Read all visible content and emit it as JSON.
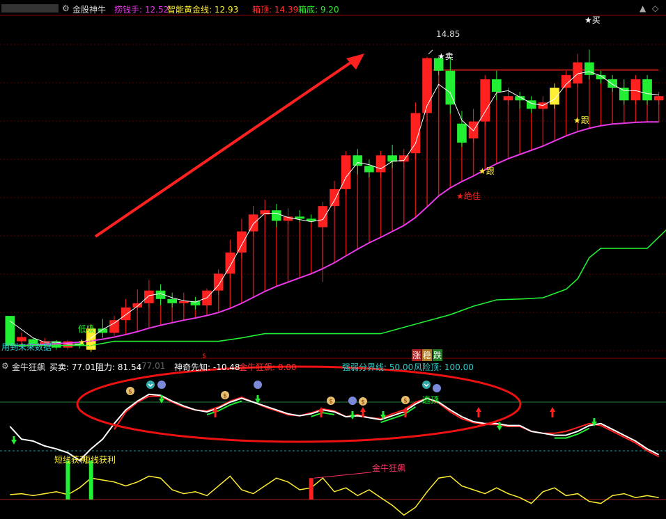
{
  "header": {
    "stock_name": "金股神牛",
    "lao_qian_shou": "捞钱手: 12.52",
    "zhi_neng_huang_jin_xian": "智能黄金线: 12.93",
    "xiang_ding": "箱顶: 14.39",
    "xiang_di": "箱底: 9.20"
  },
  "sub_header": {
    "indicator_name": "金牛狂飙",
    "mai_mai": "买卖: 77.01",
    "zu_li": "阻力: 81.54",
    "zu_li_2": "77.01",
    "shen_qi_xian_zhi": "神奇先知: -10.48",
    "jin_niu_kuang_biao": "金牛狂飙: 0.00",
    "qiang_ruo_fen_jie_xian": "强弱分界线: 50.00",
    "feng_xian_ding": "风险顶: 100.00"
  },
  "annotations": {
    "peak_price": "14.85",
    "sell_1": "卖",
    "buy_1": "买",
    "follow_1": "跟",
    "follow_2": "跟",
    "follow_3": "跟",
    "best": "绝佳",
    "low_buy": "低吸",
    "future_data": "用到未来数据",
    "zhang": "涨",
    "wen": "稳",
    "die": "跌",
    "short_profit": "短线获利",
    "gold_bull_label": "金牛狂飙",
    "escape_top": "逃顶"
  },
  "colors": {
    "up": "#ff2020",
    "down": "#22ee33",
    "yellow": "#ffee33",
    "magenta": "#e838e8",
    "white": "#ffffff",
    "cyan": "#33cccc",
    "red_annot": "#ff2020",
    "bg": "#000000"
  },
  "chart_data": [
    {
      "type": "candlestick",
      "title": "金股神牛",
      "ylim": [
        7.8,
        15.8
      ],
      "candles": [
        [
          8.72,
          8.02,
          8.02,
          8.72
        ],
        [
          8.12,
          8.22,
          8.02,
          8.32
        ],
        [
          8.17,
          8.05,
          8.0,
          8.2
        ],
        [
          8.05,
          8.12,
          7.97,
          8.2
        ],
        [
          8.12,
          7.97,
          7.92,
          8.15
        ],
        [
          7.97,
          8.12,
          7.92,
          8.15
        ],
        [
          8.07,
          8.02,
          7.95,
          8.12
        ],
        [
          7.92,
          8.42,
          7.87,
          8.52
        ],
        [
          8.42,
          8.32,
          8.2,
          8.65
        ],
        [
          8.32,
          8.62,
          8.25,
          8.72
        ],
        [
          8.62,
          8.92,
          8.55,
          9.12
        ],
        [
          8.92,
          9.02,
          8.85,
          9.35
        ],
        [
          9.02,
          9.32,
          8.92,
          9.57
        ],
        [
          9.32,
          9.12,
          8.97,
          9.47
        ],
        [
          9.12,
          9.02,
          8.92,
          9.27
        ],
        [
          9.02,
          9.07,
          8.95,
          9.27
        ],
        [
          9.07,
          8.97,
          8.87,
          9.17
        ],
        [
          8.97,
          9.32,
          8.9,
          9.37
        ],
        [
          9.32,
          9.72,
          9.22,
          9.82
        ],
        [
          9.72,
          10.22,
          9.6,
          10.52
        ],
        [
          10.22,
          10.72,
          10.07,
          11.02
        ],
        [
          10.72,
          11.12,
          10.6,
          11.32
        ],
        [
          11.12,
          11.22,
          10.97,
          11.47
        ],
        [
          11.22,
          10.97,
          10.82,
          11.37
        ],
        [
          10.97,
          11.07,
          10.9,
          11.27
        ],
        [
          11.07,
          11.02,
          10.95,
          11.22
        ],
        [
          11.02,
          10.97,
          10.92,
          11.12
        ],
        [
          10.82,
          11.32,
          9.52,
          11.42
        ],
        [
          11.32,
          11.72,
          11.2,
          11.92
        ],
        [
          11.72,
          12.52,
          11.6,
          12.62
        ],
        [
          12.52,
          12.27,
          12.07,
          12.67
        ],
        [
          12.27,
          12.12,
          12.0,
          12.42
        ],
        [
          12.12,
          12.52,
          12.0,
          12.62
        ],
        [
          12.52,
          12.37,
          12.22,
          12.77
        ],
        [
          12.37,
          12.52,
          12.22,
          12.67
        ],
        [
          12.57,
          13.52,
          12.42,
          13.77
        ],
        [
          13.52,
          14.82,
          13.32,
          14.85
        ],
        [
          14.82,
          14.52,
          14.42,
          14.85
        ],
        [
          14.52,
          13.72,
          13.5,
          14.85
        ],
        [
          13.27,
          12.82,
          12.72,
          13.57
        ],
        [
          12.92,
          13.32,
          12.82,
          13.62
        ],
        [
          13.32,
          14.32,
          13.22,
          14.42
        ],
        [
          14.32,
          14.02,
          13.82,
          14.52
        ],
        [
          13.82,
          13.92,
          13.72,
          14.12
        ],
        [
          13.92,
          13.82,
          13.62,
          14.02
        ],
        [
          13.82,
          13.62,
          13.52,
          13.92
        ],
        [
          13.62,
          13.77,
          13.57,
          13.92
        ],
        [
          13.72,
          14.12,
          13.62,
          14.22
        ],
        [
          14.12,
          14.42,
          14.02,
          14.52
        ],
        [
          14.22,
          14.72,
          14.12,
          14.92
        ],
        [
          14.72,
          14.42,
          14.32,
          15.02
        ],
        [
          14.42,
          14.32,
          14.22,
          14.52
        ],
        [
          14.32,
          14.12,
          14.02,
          14.42
        ],
        [
          14.12,
          13.82,
          13.72,
          14.32
        ],
        [
          13.82,
          14.32,
          13.72,
          14.42
        ],
        [
          14.32,
          13.82,
          13.72,
          14.42
        ],
        [
          13.82,
          13.92,
          13.72,
          14.02
        ]
      ],
      "yellow_candles": [
        7,
        47
      ],
      "pink_line": [
        8.02,
        8.02,
        8.03,
        8.05,
        8.06,
        8.08,
        8.1,
        8.13,
        8.17,
        8.22,
        8.28,
        8.35,
        8.43,
        8.5,
        8.56,
        8.62,
        8.67,
        8.73,
        8.8,
        8.9,
        9.02,
        9.16,
        9.3,
        9.42,
        9.52,
        9.62,
        9.72,
        9.84,
        9.98,
        10.14,
        10.3,
        10.45,
        10.58,
        10.72,
        10.86,
        11.05,
        11.3,
        11.56,
        11.75,
        11.9,
        12.03,
        12.18,
        12.32,
        12.44,
        12.54,
        12.64,
        12.74,
        12.86,
        12.98,
        13.08,
        13.16,
        13.22,
        13.26,
        13.28,
        13.3,
        13.31,
        13.31
      ],
      "white_line": [
        8.6,
        8.4,
        8.2,
        8.1,
        8.1,
        8.05,
        8.05,
        8.2,
        8.4,
        8.55,
        8.75,
        8.95,
        9.2,
        9.25,
        9.15,
        9.08,
        9.05,
        9.15,
        9.45,
        9.9,
        10.4,
        10.9,
        11.15,
        11.15,
        11.05,
        11.0,
        10.95,
        11.0,
        11.45,
        12.0,
        12.35,
        12.3,
        12.2,
        12.38,
        12.4,
        12.8,
        13.7,
        14.2,
        14.0,
        13.35,
        13.1,
        13.55,
        14.0,
        14.05,
        13.9,
        13.75,
        13.7,
        13.85,
        14.2,
        14.45,
        14.5,
        14.4,
        14.2,
        14.05,
        14.05,
        13.98,
        13.95
      ],
      "green_line": [
        8.02,
        8.02,
        8.02,
        8.02,
        8.02,
        8.02,
        8.02,
        8.02,
        8.02,
        8.02,
        8.02,
        8.02,
        8.02,
        8.02,
        8.02,
        8.02,
        8.02,
        8.02,
        8.02,
        8.02,
        8.02,
        8.02,
        8.02,
        8.02,
        8.02,
        8.02,
        8.02,
        8.02,
        8.02,
        8.02,
        8.02,
        8.02,
        8.02,
        8.02,
        8.02,
        8.02,
        8.02,
        8.02,
        8.02,
        8.02,
        8.02,
        8.02,
        8.02,
        8.02,
        8.02,
        8.02,
        8.02,
        8.02,
        8.02,
        8.02,
        8.02,
        8.02,
        8.02,
        8.02,
        8.02,
        8.02,
        8.02
      ],
      "green_line_poly": [
        [
          0,
          8.02
        ],
        [
          7,
          8.02
        ],
        [
          9,
          8.12
        ],
        [
          12,
          8.12
        ],
        [
          18,
          8.12
        ],
        [
          20,
          8.2
        ],
        [
          22,
          8.3
        ],
        [
          26,
          8.3
        ],
        [
          32,
          8.3
        ],
        [
          36,
          8.6
        ],
        [
          38,
          8.75
        ],
        [
          40,
          8.95
        ],
        [
          42,
          9.1
        ],
        [
          44,
          9.12
        ],
        [
          46,
          9.15
        ],
        [
          48,
          9.35
        ],
        [
          49,
          9.6
        ],
        [
          50,
          10.1
        ],
        [
          51,
          10.32
        ],
        [
          53,
          10.32
        ],
        [
          55,
          10.32
        ],
        [
          57,
          10.85
        ],
        [
          58,
          11.05
        ],
        [
          59,
          11.1
        ]
      ]
    },
    {
      "type": "line",
      "title": "金牛狂飙",
      "ylim": [
        -20,
        130
      ],
      "reference_lines": {
        "强弱分界线": 50.0,
        "风险顶": 100.0
      },
      "white": [
        75,
        62,
        60,
        55,
        52,
        48,
        40,
        52,
        62,
        78,
        92,
        101,
        108,
        107,
        101,
        96,
        92,
        90,
        94,
        100,
        104,
        100,
        96,
        92,
        88,
        86,
        88,
        92,
        90,
        85,
        86,
        84,
        82,
        86,
        90,
        98,
        104,
        100,
        92,
        85,
        80,
        78,
        78,
        76,
        76,
        70,
        68,
        66,
        66,
        70,
        76,
        78,
        72,
        66,
        60,
        52,
        46
      ],
      "red": [
        null,
        null,
        null,
        null,
        null,
        null,
        null,
        null,
        null,
        72,
        90,
        100,
        106,
        106,
        100,
        95,
        92,
        91,
        95,
        101,
        105,
        100,
        95,
        91,
        87,
        86,
        89,
        93,
        91,
        85,
        87,
        84,
        83,
        88,
        92,
        100,
        104,
        99,
        90,
        83,
        79,
        77,
        77,
        75,
        75,
        70,
        68,
        68,
        70,
        74,
        78,
        76,
        70,
        64,
        58,
        50,
        44
      ],
      "green": [
        null,
        null,
        null,
        null,
        null,
        null,
        null,
        null,
        null,
        null,
        null,
        null,
        null,
        null,
        null,
        null,
        null,
        null,
        null,
        null,
        null,
        null,
        null,
        null,
        null,
        null,
        null,
        null,
        null,
        null,
        null,
        null,
        null,
        null,
        null,
        null,
        null,
        null,
        null,
        null,
        null,
        null,
        null,
        null,
        null,
        null,
        null,
        null,
        null,
        null,
        null,
        null,
        null,
        null,
        null,
        null,
        null
      ],
      "yellow": [
        5,
        6,
        4,
        6,
        8,
        5,
        12,
        22,
        20,
        18,
        14,
        18,
        24,
        22,
        10,
        6,
        8,
        4,
        14,
        24,
        10,
        6,
        14,
        22,
        18,
        10,
        12,
        22,
        8,
        12,
        4,
        10,
        2,
        -6,
        -16,
        -8,
        8,
        22,
        24,
        14,
        10,
        6,
        12,
        6,
        2,
        -4,
        8,
        12,
        4,
        6,
        -2,
        -4,
        4,
        6,
        2,
        4,
        2
      ],
      "gold_bull_spike_index": 26,
      "short_profit_bars": [
        5,
        7
      ]
    }
  ]
}
